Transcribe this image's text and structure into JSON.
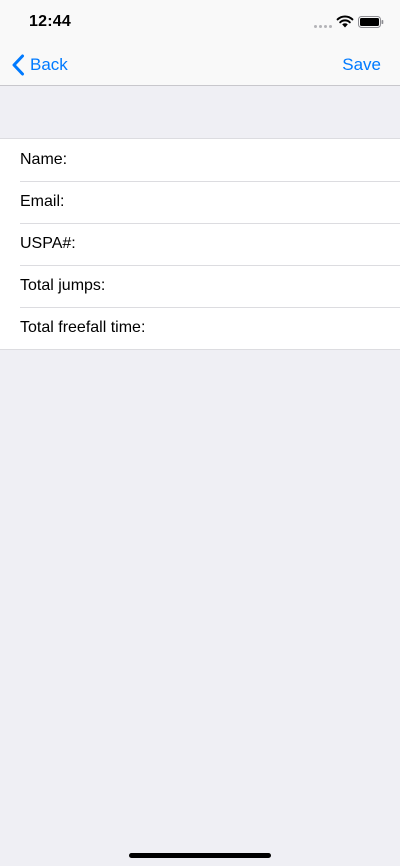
{
  "status_bar": {
    "time": "12:44"
  },
  "nav": {
    "back_label": "Back",
    "save_label": "Save"
  },
  "form": {
    "fields": [
      {
        "label": "Name:"
      },
      {
        "label": "Email:"
      },
      {
        "label": "USPA#:"
      },
      {
        "label": "Total jumps:"
      },
      {
        "label": "Total freefall time:"
      }
    ]
  },
  "colors": {
    "accent": "#007aff",
    "background": "#efeff4",
    "row_background": "#ffffff"
  },
  "icons": {
    "back": "chevron-left-icon",
    "wifi": "wifi-icon",
    "battery": "battery-icon"
  }
}
